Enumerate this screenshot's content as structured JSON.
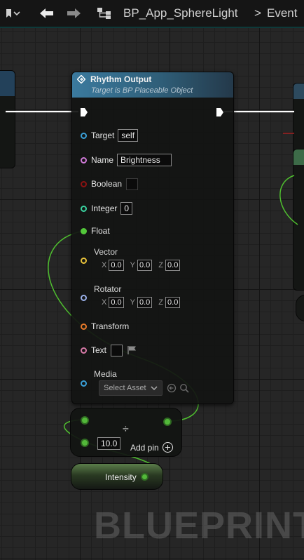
{
  "toolbar": {
    "breadcrumb_graph": "BP_App_SphereLight",
    "breadcrumb_separator": ">",
    "breadcrumb_event": "Event"
  },
  "node": {
    "title": "Rhythm Output",
    "subtitle": "Target is BP Placeable Object",
    "pins": {
      "target": {
        "label": "Target",
        "value": "self",
        "color": "#3aa0d8"
      },
      "name": {
        "label": "Name",
        "value": "Brightness",
        "color": "#d07ad8"
      },
      "boolean": {
        "label": "Boolean",
        "color": "#8c1212"
      },
      "integer": {
        "label": "Integer",
        "value": "0",
        "color": "#3ad3a0"
      },
      "float": {
        "label": "Float",
        "color": "#53c83a"
      },
      "vector": {
        "label": "Vector",
        "x": "0.0",
        "y": "0.0",
        "z": "0.0",
        "color": "#e8c23a"
      },
      "rotator": {
        "label": "Rotator",
        "x": "0.0",
        "y": "0.0",
        "z": "0.0",
        "color": "#9ab0e8"
      },
      "transform": {
        "label": "Transform",
        "color": "#e8782a"
      },
      "text": {
        "label": "Text",
        "color": "#d87aa8"
      },
      "media": {
        "label": "Media",
        "placeholder": "Select Asset",
        "color": "#3aa0d8"
      }
    },
    "axis_labels": {
      "x": "X",
      "y": "Y",
      "z": "Z"
    }
  },
  "math_node": {
    "operator": "÷",
    "value": "10.0",
    "add_pin_label": "Add pin"
  },
  "variable_node": {
    "label": "Intensity"
  },
  "watermark": "BLUEPRINT"
}
